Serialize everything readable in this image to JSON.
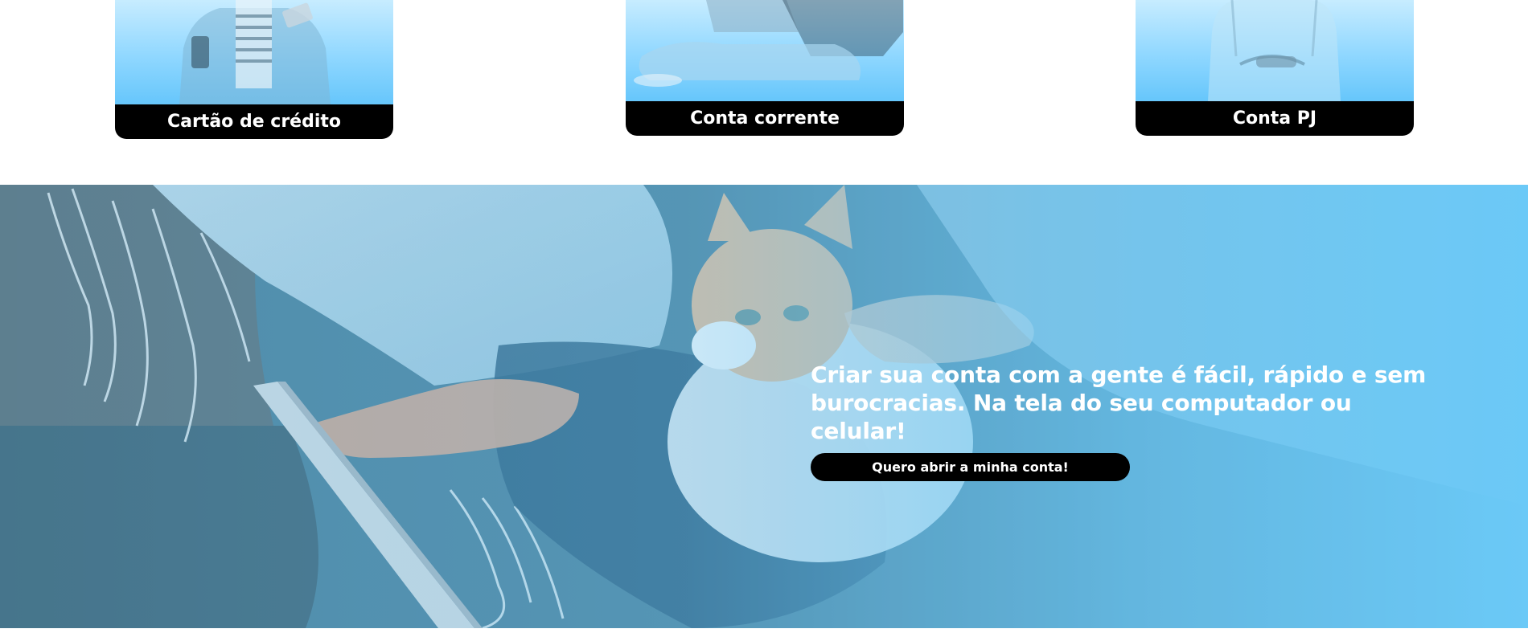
{
  "cards": [
    {
      "label": "Cartão de crédito"
    },
    {
      "label": "Conta corrente"
    },
    {
      "label": "Conta PJ"
    }
  ],
  "hero": {
    "text": "Criar sua conta com a gente é fácil, rápido e sem burocracias. Na tela do seu computador ou celular!",
    "cta_label": "Quero abrir a minha conta!"
  },
  "colors": {
    "accent": "#6ccaf7",
    "label_bg": "#000000",
    "text_on_dark": "#ffffff"
  }
}
